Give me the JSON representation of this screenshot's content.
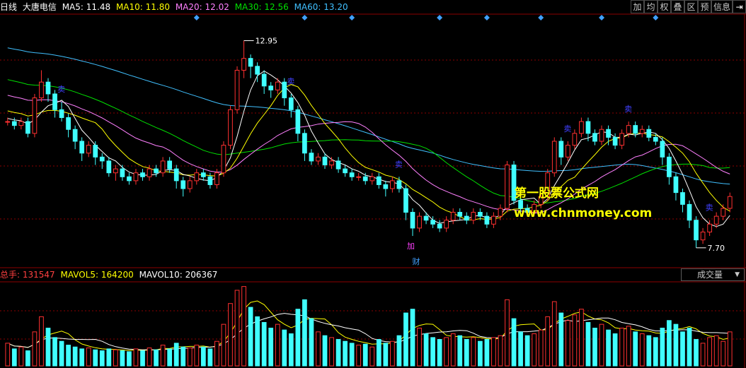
{
  "header": {
    "period": "日线",
    "stock_name": "大唐电信",
    "ma5_label": "MA5: 11.48",
    "ma10_label": "MA10: 11.80",
    "ma20_label": "MA20: 12.02",
    "ma30_label": "MA30: 12.56",
    "ma60_label": "MA60: 13.20"
  },
  "toolbar": [
    "加",
    "均",
    "权",
    "叠",
    "区",
    "预",
    "信息"
  ],
  "toolbar_extra_icon": "panel-switch-icon",
  "volume_header": {
    "total": "总手: 131547",
    "mavol5": "MAVOL5: 164200",
    "mavol10": "MAVOL10: 206367"
  },
  "volume_dropdown": "成交量",
  "watermark": {
    "line1": "第一股票公式网",
    "line2": "www.chnmoney.com"
  },
  "annotations": {
    "high_label": "12.95",
    "low_label": "7.70",
    "add_label": "加",
    "finance_label": "财",
    "sell_label": "卖"
  },
  "colors": {
    "up": "#ff3030",
    "down": "#40ffff",
    "ma5": "#ffffff",
    "ma10": "#ffff00",
    "ma20": "#ff80ff",
    "ma30": "#00e000",
    "ma60": "#40c0ff",
    "grid": "#8b0000",
    "sell_mark": "#4040ff",
    "diamond": "#40a0ff"
  },
  "chart_data": {
    "type": "candlestick",
    "price_range": [
      7.7,
      12.95
    ],
    "high_marker": 12.95,
    "low_marker": 7.7,
    "ma_last": {
      "MA5": 11.48,
      "MA10": 11.8,
      "MA20": 12.02,
      "MA30": 12.56,
      "MA60": 13.2
    },
    "volume_last": {
      "total": 131547,
      "MAVOL5": 164200,
      "MAVOL10": 206367
    },
    "candles": [
      [
        10.9,
        10.9,
        11.0,
        10.8
      ],
      [
        10.9,
        10.8,
        11.0,
        10.7
      ],
      [
        10.8,
        10.9,
        11.0,
        10.7
      ],
      [
        10.9,
        10.6,
        11.0,
        10.5
      ],
      [
        10.6,
        11.5,
        11.6,
        10.5
      ],
      [
        11.5,
        11.9,
        12.2,
        11.4
      ],
      [
        11.9,
        11.6,
        12.0,
        11.4
      ],
      [
        11.6,
        11.2,
        11.7,
        11.0
      ],
      [
        11.2,
        11.0,
        11.4,
        10.9
      ],
      [
        11.0,
        10.7,
        11.1,
        10.5
      ],
      [
        10.7,
        10.4,
        10.8,
        10.2
      ],
      [
        10.4,
        10.1,
        10.5,
        9.9
      ],
      [
        10.1,
        10.3,
        10.4,
        10.0
      ],
      [
        10.3,
        10.0,
        10.4,
        9.8
      ],
      [
        10.0,
        9.9,
        10.1,
        9.7
      ],
      [
        9.9,
        9.6,
        10.0,
        9.5
      ],
      [
        9.6,
        9.7,
        9.8,
        9.4
      ],
      [
        9.7,
        9.5,
        9.8,
        9.4
      ],
      [
        9.5,
        9.4,
        9.6,
        9.3
      ],
      [
        9.4,
        9.6,
        9.7,
        9.3
      ],
      [
        9.6,
        9.5,
        9.7,
        9.4
      ],
      [
        9.5,
        9.7,
        9.8,
        9.4
      ],
      [
        9.7,
        9.6,
        9.8,
        9.5
      ],
      [
        9.6,
        9.9,
        10.0,
        9.5
      ],
      [
        9.9,
        9.7,
        10.0,
        9.6
      ],
      [
        9.7,
        9.4,
        9.8,
        9.2
      ],
      [
        9.4,
        9.2,
        9.5,
        9.0
      ],
      [
        9.2,
        9.4,
        9.5,
        9.1
      ],
      [
        9.4,
        9.6,
        9.7,
        9.3
      ],
      [
        9.6,
        9.5,
        9.7,
        9.4
      ],
      [
        9.5,
        9.3,
        9.6,
        9.2
      ],
      [
        9.3,
        9.6,
        9.7,
        9.2
      ],
      [
        9.6,
        10.3,
        10.4,
        9.5
      ],
      [
        10.3,
        11.2,
        11.3,
        10.2
      ],
      [
        11.2,
        12.2,
        12.3,
        11.1
      ],
      [
        12.2,
        12.5,
        12.95,
        12.0
      ],
      [
        12.5,
        12.3,
        12.6,
        12.0
      ],
      [
        12.3,
        12.1,
        12.4,
        11.9
      ],
      [
        12.1,
        11.8,
        12.2,
        11.6
      ],
      [
        11.8,
        11.7,
        11.9,
        11.5
      ],
      [
        11.7,
        11.9,
        12.0,
        11.6
      ],
      [
        11.9,
        11.5,
        12.0,
        11.3
      ],
      [
        11.5,
        11.2,
        11.6,
        11.0
      ],
      [
        11.2,
        10.6,
        11.3,
        10.4
      ],
      [
        10.6,
        10.1,
        10.7,
        9.9
      ],
      [
        10.1,
        9.9,
        10.2,
        9.8
      ],
      [
        9.9,
        10.0,
        10.1,
        9.8
      ],
      [
        10.0,
        9.8,
        10.1,
        9.7
      ],
      [
        9.8,
        9.9,
        10.0,
        9.7
      ],
      [
        9.9,
        9.7,
        10.0,
        9.6
      ],
      [
        9.7,
        9.6,
        9.8,
        9.5
      ],
      [
        9.6,
        9.5,
        9.7,
        9.4
      ],
      [
        9.5,
        9.5,
        9.6,
        9.4
      ],
      [
        9.5,
        9.4,
        9.6,
        9.3
      ],
      [
        9.4,
        9.5,
        9.6,
        9.3
      ],
      [
        9.5,
        9.3,
        9.6,
        9.2
      ],
      [
        9.3,
        9.2,
        9.4,
        9.0
      ],
      [
        9.2,
        9.4,
        9.5,
        9.1
      ],
      [
        9.4,
        9.2,
        9.5,
        9.1
      ],
      [
        9.2,
        8.6,
        9.3,
        8.4
      ],
      [
        8.6,
        8.2,
        8.7,
        8.0
      ],
      [
        8.2,
        8.5,
        8.6,
        8.1
      ],
      [
        8.5,
        8.4,
        8.6,
        8.3
      ],
      [
        8.4,
        8.3,
        8.5,
        8.2
      ],
      [
        8.3,
        8.2,
        8.4,
        8.1
      ],
      [
        8.2,
        8.4,
        8.5,
        8.1
      ],
      [
        8.4,
        8.6,
        8.7,
        8.3
      ],
      [
        8.6,
        8.5,
        8.7,
        8.4
      ],
      [
        8.5,
        8.4,
        8.6,
        8.3
      ],
      [
        8.4,
        8.6,
        8.7,
        8.3
      ],
      [
        8.6,
        8.5,
        8.7,
        8.4
      ],
      [
        8.5,
        8.3,
        8.6,
        8.2
      ],
      [
        8.3,
        8.5,
        8.6,
        8.2
      ],
      [
        8.5,
        8.7,
        8.8,
        8.4
      ],
      [
        8.7,
        9.8,
        9.9,
        8.6
      ],
      [
        9.8,
        8.9,
        9.9,
        8.8
      ],
      [
        8.9,
        8.7,
        9.0,
        8.6
      ],
      [
        8.7,
        8.6,
        8.8,
        8.5
      ],
      [
        8.6,
        8.8,
        8.9,
        8.5
      ],
      [
        8.8,
        9.0,
        9.1,
        8.7
      ],
      [
        9.0,
        9.6,
        9.7,
        8.9
      ],
      [
        9.6,
        10.4,
        10.5,
        9.5
      ],
      [
        10.4,
        10.0,
        10.5,
        9.8
      ],
      [
        10.0,
        10.3,
        10.4,
        9.9
      ],
      [
        10.3,
        10.6,
        10.7,
        10.2
      ],
      [
        10.6,
        10.9,
        11.0,
        10.5
      ],
      [
        10.9,
        10.6,
        11.0,
        10.4
      ],
      [
        10.6,
        10.4,
        10.7,
        10.3
      ],
      [
        10.4,
        10.7,
        10.8,
        10.3
      ],
      [
        10.7,
        10.5,
        10.8,
        10.3
      ],
      [
        10.5,
        10.3,
        10.6,
        10.2
      ],
      [
        10.3,
        10.6,
        10.7,
        10.2
      ],
      [
        10.6,
        10.8,
        10.9,
        10.5
      ],
      [
        10.8,
        10.6,
        10.9,
        10.5
      ],
      [
        10.6,
        10.7,
        10.8,
        10.5
      ],
      [
        10.7,
        10.5,
        10.8,
        10.4
      ],
      [
        10.5,
        10.4,
        10.6,
        10.3
      ],
      [
        10.4,
        10.0,
        10.5,
        9.8
      ],
      [
        10.0,
        9.5,
        10.1,
        9.3
      ],
      [
        9.5,
        9.1,
        9.6,
        8.9
      ],
      [
        9.1,
        8.8,
        9.2,
        8.6
      ],
      [
        8.8,
        8.4,
        8.9,
        8.2
      ],
      [
        8.4,
        7.9,
        8.5,
        7.7
      ],
      [
        7.9,
        8.1,
        8.2,
        7.8
      ],
      [
        8.1,
        8.3,
        8.4,
        8.0
      ],
      [
        8.3,
        8.5,
        8.6,
        8.2
      ],
      [
        8.5,
        8.7,
        8.8,
        8.4
      ],
      [
        8.7,
        9.0,
        9.1,
        8.6
      ]
    ],
    "volume": [
      120,
      90,
      100,
      80,
      180,
      260,
      200,
      150,
      130,
      110,
      100,
      90,
      95,
      85,
      80,
      90,
      85,
      80,
      75,
      90,
      80,
      95,
      85,
      110,
      90,
      120,
      100,
      95,
      110,
      100,
      90,
      130,
      220,
      330,
      400,
      420,
      310,
      260,
      230,
      200,
      220,
      190,
      170,
      300,
      350,
      250,
      180,
      160,
      150,
      140,
      130,
      120,
      110,
      115,
      100,
      140,
      120,
      130,
      160,
      280,
      300,
      200,
      170,
      150,
      140,
      150,
      170,
      160,
      140,
      150,
      130,
      140,
      150,
      160,
      350,
      250,
      180,
      160,
      170,
      190,
      260,
      340,
      280,
      240,
      270,
      300,
      230,
      200,
      220,
      190,
      170,
      200,
      210,
      180,
      170,
      160,
      150,
      200,
      240,
      220,
      180,
      200,
      140,
      120,
      150,
      160,
      130,
      180
    ]
  }
}
